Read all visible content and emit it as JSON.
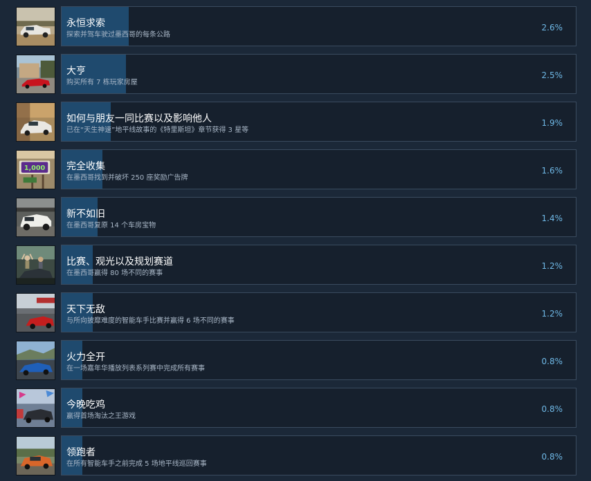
{
  "achievements": [
    {
      "title": "永恒求索",
      "description": "探索并驾车驶过墨西哥的每条公路",
      "percent_label": "2.6%",
      "percent": 2.6,
      "thumbnail": "white-pickup-truck-on-dirt"
    },
    {
      "title": "大亨",
      "description": "购买所有 7 栋玩家房屋",
      "percent_label": "2.5%",
      "percent": 2.5,
      "thumbnail": "red-sports-car-by-house"
    },
    {
      "title": "如何与朋友一同比赛以及影响他人",
      "description": "已在“天生神速”地平线故事的《特里斯坦》章节获得 3 星等",
      "percent_label": "1.9%",
      "percent": 1.9,
      "thumbnail": "white-classic-car"
    },
    {
      "title": "完全收集",
      "description": "在墨西哥找到并破坏 250 座奖励广告牌",
      "percent_label": "1.6%",
      "percent": 1.6,
      "thumbnail": "bonus-board-sign"
    },
    {
      "title": "新不如旧",
      "description": "在墨西哥复原 14 个车房宝物",
      "percent_label": "1.4%",
      "percent": 1.4,
      "thumbnail": "white-offroad-truck-in-garage"
    },
    {
      "title": "比赛、观光以及规划赛道",
      "description": "在墨西哥赢得 80 场不同的赛事",
      "percent_label": "1.2%",
      "percent": 1.2,
      "thumbnail": "car-with-crowd-celebrating"
    },
    {
      "title": "天下无敌",
      "description": "与所向披靡难度的智能车手比赛并赢得 6 场不同的赛事",
      "percent_label": "1.2%",
      "percent": 1.2,
      "thumbnail": "red-race-car-on-track"
    },
    {
      "title": "火力全开",
      "description": "在一场嘉年华播放列表系列赛中完成所有赛事",
      "percent_label": "0.8%",
      "percent": 0.8,
      "thumbnail": "blue-supercar-on-road"
    },
    {
      "title": "今晚吃鸡",
      "description": "赢得首场淘汰之王游戏",
      "percent_label": "0.8%",
      "percent": 0.8,
      "thumbnail": "dark-car-with-flags"
    },
    {
      "title": "领跑者",
      "description": "在所有智能车手之前完成 5 场地平线巡回赛事",
      "percent_label": "0.8%",
      "percent": 0.8,
      "thumbnail": "orange-muscle-car"
    }
  ],
  "colors": {
    "background": "#1b2838",
    "card_border": "#3a4b5f",
    "progress_fill": "#1f4a6e",
    "percent_text": "#6fb8e6",
    "description_text": "#a9b7c7"
  }
}
